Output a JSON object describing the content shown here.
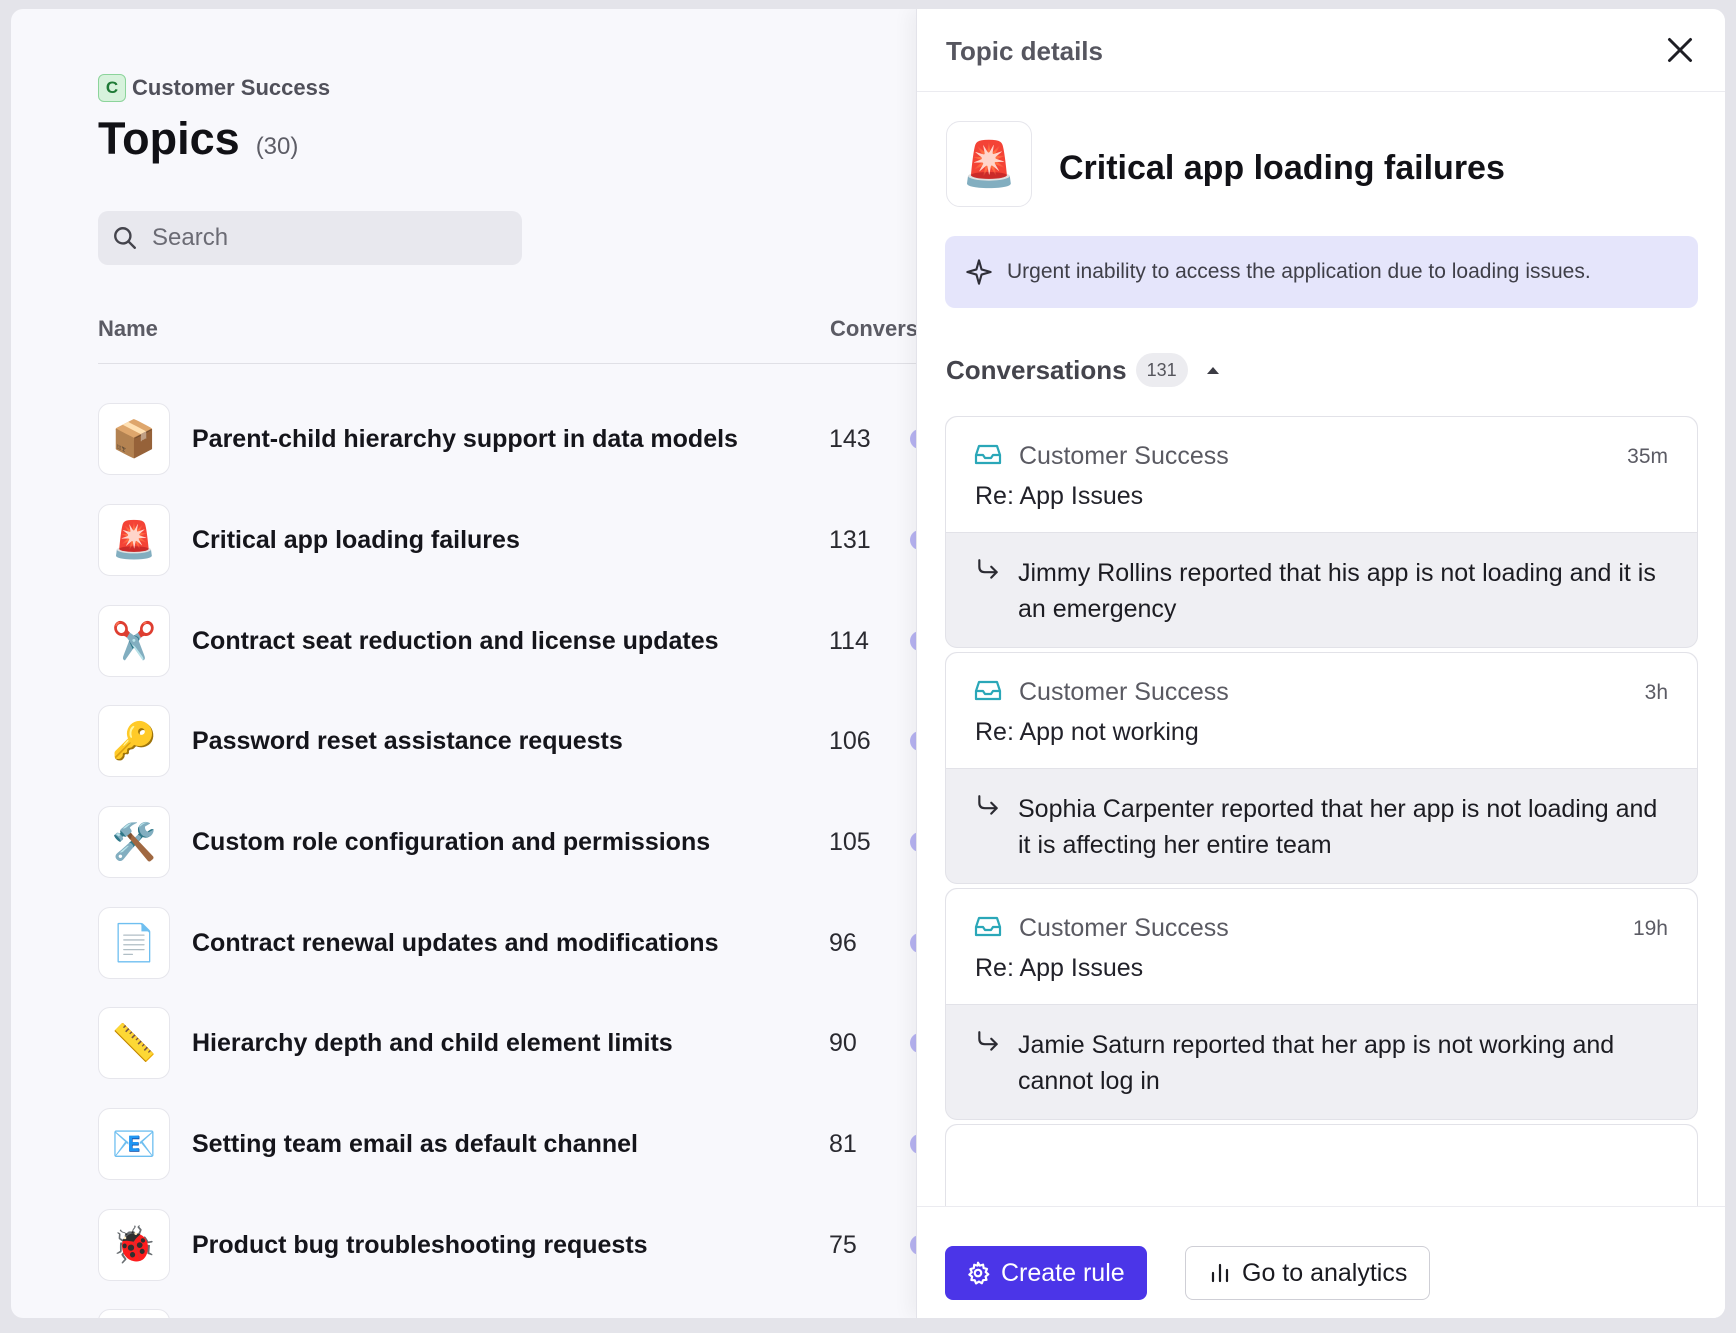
{
  "workspace": {
    "badge": "C",
    "name": "Customer Success"
  },
  "page": {
    "title": "Topics",
    "count": "(30)"
  },
  "search": {
    "placeholder": "Search"
  },
  "table": {
    "columns": {
      "name": "Name",
      "conversations": "Conversations"
    },
    "rows": [
      {
        "icon": "📦",
        "name": "Parent-child hierarchy support in data models",
        "count": "143"
      },
      {
        "icon": "🚨",
        "name": "Critical app loading failures",
        "count": "131"
      },
      {
        "icon": "✂️",
        "name": "Contract seat reduction and license updates",
        "count": "114"
      },
      {
        "icon": "🔑",
        "name": "Password reset assistance requests",
        "count": "106"
      },
      {
        "icon": "🛠️",
        "name": "Custom role configuration and permissions",
        "count": "105"
      },
      {
        "icon": "📄",
        "name": "Contract renewal updates and modifications",
        "count": "96"
      },
      {
        "icon": "📏",
        "name": "Hierarchy depth and child element limits",
        "count": "90"
      },
      {
        "icon": "📧",
        "name": "Setting team email as default channel",
        "count": "81"
      },
      {
        "icon": "🐞",
        "name": "Product bug troubleshooting requests",
        "count": "75"
      }
    ]
  },
  "drawer": {
    "title": "Topic details",
    "topic": {
      "icon": "🚨",
      "name": "Critical app loading failures",
      "summary": "Urgent inability to access the application due to loading issues."
    },
    "conversations": {
      "label": "Conversations",
      "count": "131",
      "items": [
        {
          "channel": "Customer Success",
          "time": "35m",
          "subject": "Re: App Issues",
          "summary": "Jimmy Rollins reported that his app is not loading and it is an emergency"
        },
        {
          "channel": "Customer Success",
          "time": "3h",
          "subject": "Re: App not working",
          "summary": "Sophia Carpenter reported that her app is not loading and it is affecting her entire team"
        },
        {
          "channel": "Customer Success",
          "time": "19h",
          "subject": "Re: App Issues",
          "summary": "Jamie Saturn reported that her app is not working and cannot log in"
        }
      ]
    },
    "actions": {
      "create_rule": "Create rule",
      "analytics": "Go to analytics"
    }
  },
  "colors": {
    "accent": "#4b35e8",
    "summary_bg": "#e5e5fb",
    "inbox_icon": "#2aa7b8",
    "bar": "#b7b3f2"
  }
}
